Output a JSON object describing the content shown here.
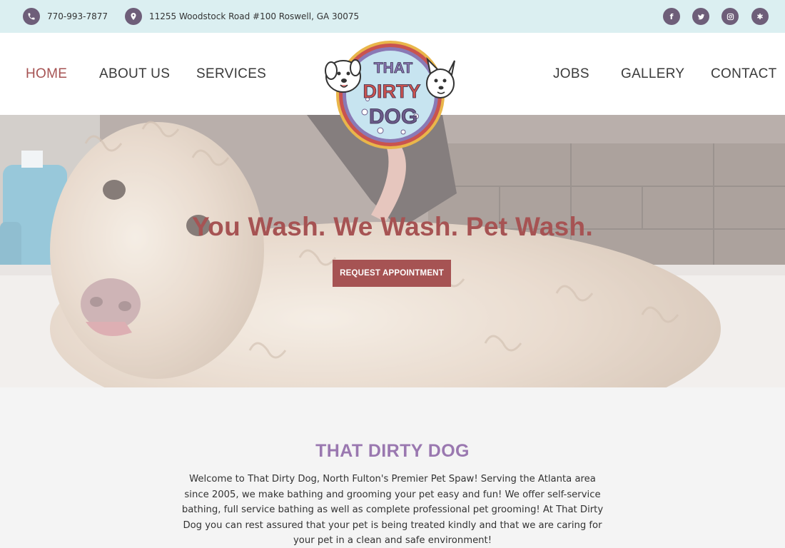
{
  "topbar": {
    "phone": "770-993-7877",
    "address": "11255 Woodstock Road #100 Roswell, GA 30075",
    "social": [
      {
        "icon": "facebook-icon",
        "glyph": "f"
      },
      {
        "icon": "twitter-icon",
        "glyph": "t"
      },
      {
        "icon": "instagram-icon",
        "glyph": "◎"
      },
      {
        "icon": "yelp-icon",
        "glyph": "✱"
      }
    ]
  },
  "nav": {
    "home": "HOME",
    "about": "ABOUT US",
    "services": "SERVICES",
    "jobs": "JOBS",
    "gallery": "GALLERY",
    "contact": "CONTACT"
  },
  "logo": {
    "line1": "THAT",
    "line2": "DIRTY",
    "line3": "DOG"
  },
  "hero": {
    "title": "You Wash. We Wash. Pet Wash.",
    "button": "REQUEST APPOINTMENT"
  },
  "welcome": {
    "title": "THAT DIRTY DOG",
    "text": "Welcome to That Dirty Dog, North Fulton's Premier Pet Spaw! Serving the Atlanta area since 2005, we make bathing and grooming your pet easy and fun! We offer self-service bathing, full service bathing as well as complete professional pet grooming! At That Dirty Dog you can rest assured that your pet is being treated kindly and that we are caring for your pet in a clean and safe environment!"
  },
  "colors": {
    "accent": "#a65353",
    "topbar_bg": "#dbeff1",
    "icon_circle": "#6e5e79",
    "title_purple": "#9a78b0"
  }
}
